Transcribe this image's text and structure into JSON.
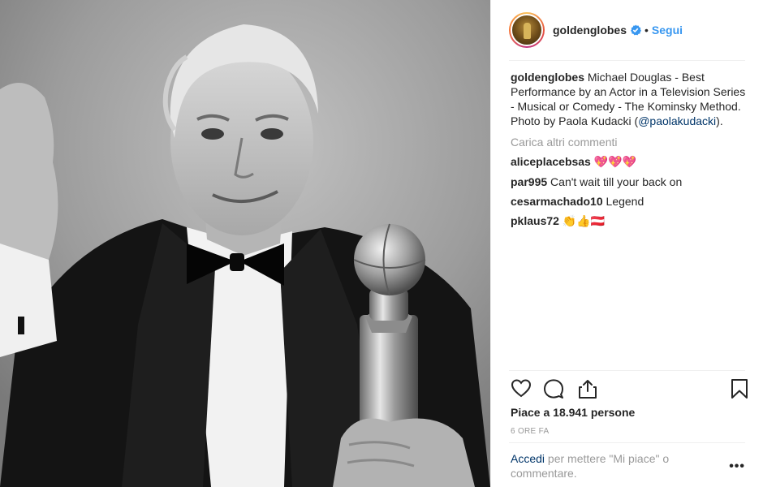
{
  "post": {
    "username": "goldenglobes",
    "follow_label": "Segui",
    "separator": "•",
    "caption_user": "goldenglobes",
    "caption_text": "Michael Douglas - Best Performance by an Actor in a Television Series - Musical or Comedy - The Kominsky Method. Photo by Paola Kudacki (",
    "caption_mention": "@paolakudacki",
    "caption_end": ").",
    "load_more": "Carica altri commenti",
    "comments": [
      {
        "user": "aliceplacebsas",
        "text": "💖💖💖"
      },
      {
        "user": "par995",
        "text": "Can't wait till your back on"
      },
      {
        "user": "cesarmachado10",
        "text": "Legend"
      },
      {
        "user": "pklaus72",
        "text": "👏👍🇦🇹"
      }
    ],
    "likes": "Piace a 18.941 persone",
    "time": "6 ORE FA",
    "login_link": "Accedi",
    "login_text": " per mettere \"Mi piace\" o commentare.",
    "more": "•••"
  },
  "icons": {
    "avatar": "profile-avatar",
    "verified": "verified-badge-icon",
    "like": "heart-icon",
    "comment": "comment-bubble-icon",
    "share": "share-icon",
    "save": "bookmark-icon",
    "options": "more-options-icon"
  },
  "colors": {
    "link_blue": "#3897f0",
    "mention": "#003569",
    "muted": "#999999",
    "text": "#262626"
  }
}
